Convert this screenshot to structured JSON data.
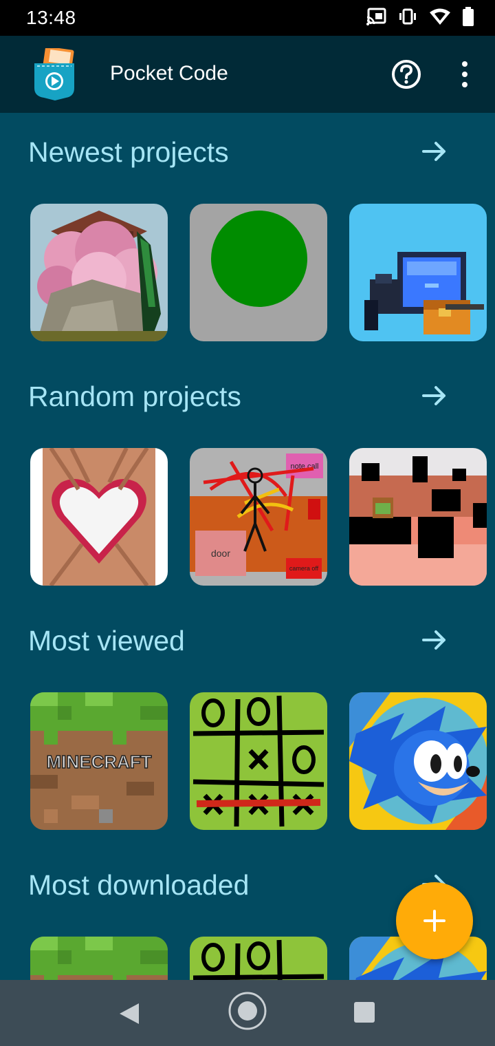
{
  "status_bar": {
    "time": "13:48",
    "icons": [
      "cast-icon",
      "vibrate-icon",
      "wifi-icon",
      "battery-icon"
    ]
  },
  "app_bar": {
    "title": "Pocket Code",
    "logo_icon": "pocket-code-logo",
    "actions": [
      "help-icon",
      "more-vert-icon"
    ]
  },
  "colors": {
    "background": "#024b61",
    "app_bar": "#012a37",
    "section_title": "#a6e5f5",
    "fab": "#ffab08",
    "nav_bar": "#3d4c56"
  },
  "sections": [
    {
      "title": "Newest projects",
      "arrow_icon": "arrow-right-icon",
      "projects": [
        "cherry-blossom-knife",
        "green-circle",
        "pixel-jar-character"
      ]
    },
    {
      "title": "Random projects",
      "arrow_icon": "arrow-right-icon",
      "projects": [
        "heart-of-hands",
        "stick-figure-scene",
        "pixel-desert-level"
      ]
    },
    {
      "title": "Most viewed",
      "arrow_icon": "arrow-right-icon",
      "projects": [
        "minecraft",
        "tic-tac-toe",
        "sonic"
      ]
    },
    {
      "title": "Most downloaded",
      "arrow_icon": "arrow-right-icon",
      "projects": [
        "minecraft",
        "tic-tac-toe",
        "sonic"
      ]
    }
  ],
  "tile_text": {
    "minecraft": "MINECRAFT",
    "door": "door",
    "note_call": "note call",
    "camera_off": "camera off"
  },
  "fab": {
    "icon": "plus-icon"
  },
  "nav_bar": {
    "icons": [
      "back-icon",
      "home-icon",
      "recents-icon"
    ]
  }
}
